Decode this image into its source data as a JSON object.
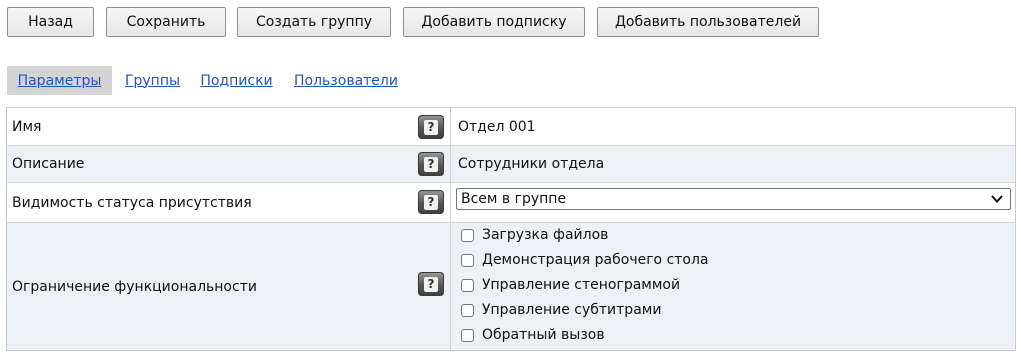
{
  "toolbar": {
    "back_label": "Назад",
    "save_label": "Сохранить",
    "create_group_label": "Создать группу",
    "add_subscription_label": "Добавить подписку",
    "add_users_label": "Добавить пользователей"
  },
  "tabs": [
    {
      "label": "Параметры",
      "active": true
    },
    {
      "label": "Группы",
      "active": false
    },
    {
      "label": "Подписки",
      "active": false
    },
    {
      "label": "Пользователи",
      "active": false
    }
  ],
  "fields": {
    "name": {
      "label": "Имя",
      "value": "Отдел 001"
    },
    "description": {
      "label": "Описание",
      "value": "Сотрудники отдела"
    },
    "presence": {
      "label": "Видимость статуса присутствия",
      "selected": "Всем в группе"
    },
    "restrictions": {
      "label": "Ограничение функциональности",
      "options": [
        {
          "label": "Загрузка файлов",
          "checked": false
        },
        {
          "label": "Демонстрация рабочего стола",
          "checked": false
        },
        {
          "label": "Управление стенограммой",
          "checked": false
        },
        {
          "label": "Управление субтитрами",
          "checked": false
        },
        {
          "label": "Обратный вызов",
          "checked": false
        }
      ]
    }
  },
  "help_icon_glyph": "?",
  "icons": {
    "help": "help-icon",
    "select_arrow": "chevron-down-icon"
  },
  "colors": {
    "link": "#1f57b8",
    "active_tab_bg": "#d4d4d4",
    "alt_row_bg": "#edf0f4"
  }
}
